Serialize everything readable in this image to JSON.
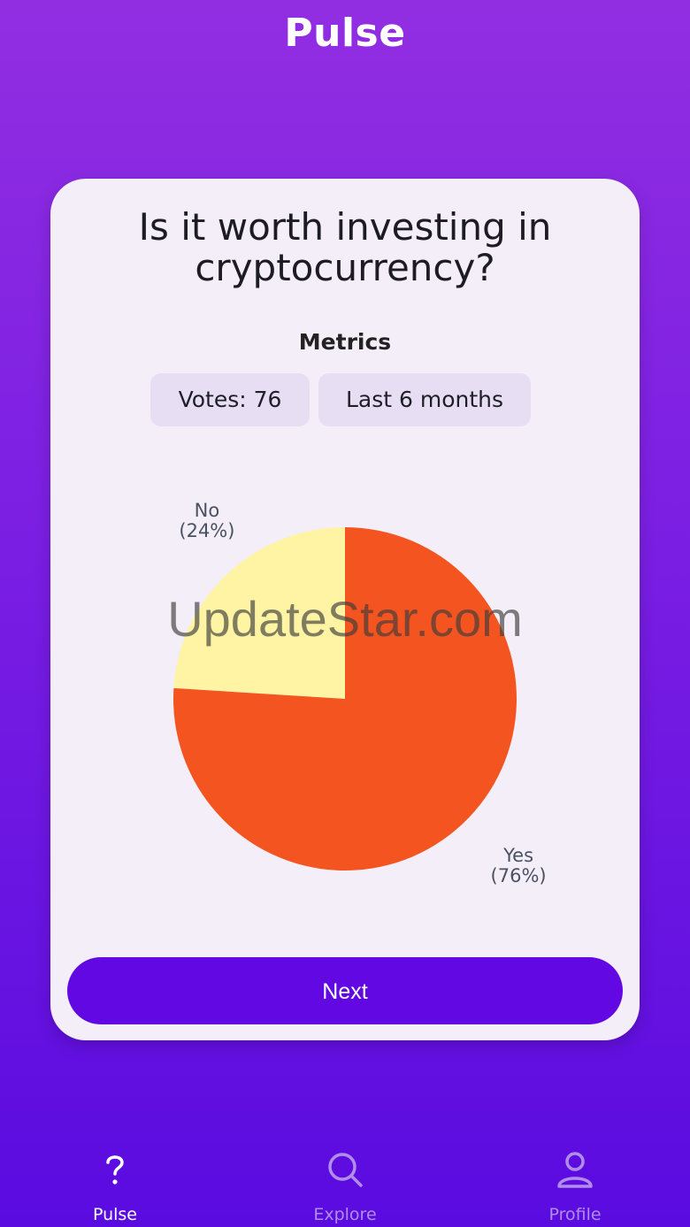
{
  "app": {
    "title": "Pulse"
  },
  "card": {
    "question": "Is it worth investing in cryptocurrency?",
    "metrics_title": "Metrics",
    "chips": {
      "votes": "Votes: 76",
      "period": "Last 6 months"
    },
    "next_label": "Next",
    "watermark": "UpdateStar.com"
  },
  "chart_data": {
    "type": "pie",
    "slices": [
      {
        "label": "No",
        "value_label": "(24%)",
        "value": 24,
        "color": "#fff4a3"
      },
      {
        "label": "Yes",
        "value_label": "(76%)",
        "value": 76,
        "color": "#f4541f"
      }
    ]
  },
  "tabs": [
    {
      "label": "Pulse",
      "icon": "question-icon",
      "active": true
    },
    {
      "label": "Explore",
      "icon": "search-icon",
      "active": false
    },
    {
      "label": "Profile",
      "icon": "profile-icon",
      "active": false
    }
  ],
  "colors": {
    "accent": "#6209e3",
    "chip": "#e7def3",
    "card": "#f3eef7"
  }
}
